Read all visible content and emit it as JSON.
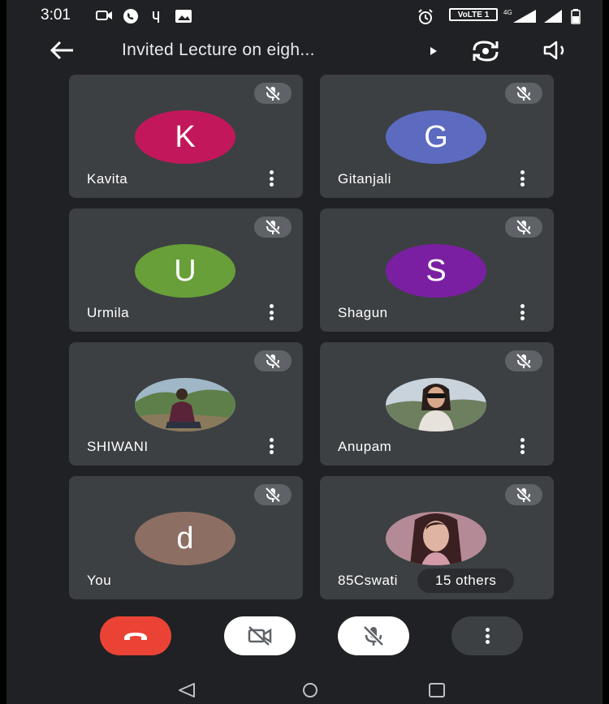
{
  "status_bar": {
    "time": "3:01",
    "volte_label": "VoLTE 1",
    "network": "4G"
  },
  "header": {
    "title": "Invited Lecture on eigh..."
  },
  "participants": [
    {
      "name": "Kavita",
      "initial": "K",
      "avatar_color": "#c2185b"
    },
    {
      "name": "Gitanjali",
      "initial": "G",
      "avatar_color": "#5c6bc0"
    },
    {
      "name": "Urmila",
      "initial": "U",
      "avatar_color": "#689f38"
    },
    {
      "name": "Shagun",
      "initial": "S",
      "avatar_color": "#7b1fa2"
    },
    {
      "name": "SHIWANI",
      "initial": "",
      "avatar_color": "#6b8e5a"
    },
    {
      "name": "Anupam",
      "initial": "",
      "avatar_color": "#8aa0b0"
    },
    {
      "name": "You",
      "initial": "d",
      "avatar_color": "#8d6e63"
    },
    {
      "name": "85Cswati",
      "initial": "",
      "avatar_color": "#a06a7a",
      "others_label": "15 others"
    }
  ],
  "controls": {
    "end_call_color": "#ea4335",
    "camera_off_icon": "camera-off-icon",
    "mic_off_icon": "mic-off-icon",
    "more_options_icon": "more-vert-icon"
  },
  "colors": {
    "background": "#202124",
    "tile": "#3c4043",
    "badge": "#5f6368"
  }
}
